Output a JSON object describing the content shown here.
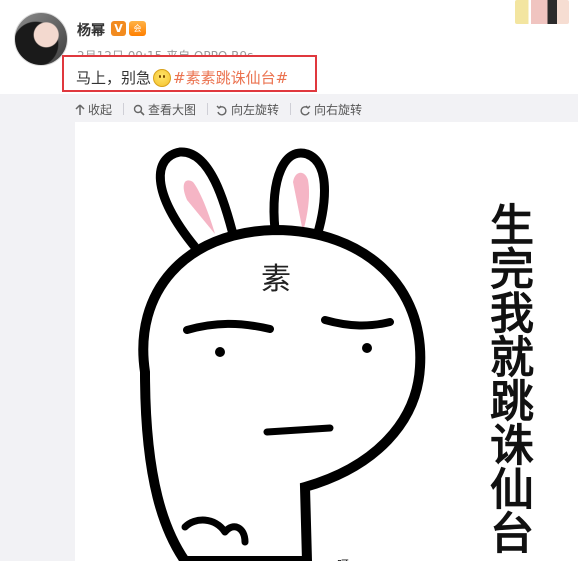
{
  "post": {
    "author": "杨幂",
    "verified_badge": "V",
    "vip_badge": "会",
    "meta": "2月12日 09:15 来自 OPPO R9s",
    "text_before": "马上，别急",
    "emoji": "smile-emoji",
    "hashtag": "#素素跳诛仙台#"
  },
  "toolbar": {
    "collapse_label": "收起",
    "view_large_label": "查看大图",
    "rotate_left_label": "向左旋转",
    "rotate_right_label": "向右旋转"
  },
  "image": {
    "stamp_text": "素",
    "caption_vertical": "生完我就跳诛仙台",
    "bottom_mark": "呀"
  },
  "colors": {
    "highlight_border": "#e0383e",
    "hashtag": "#eb7350",
    "toolbar_bg": "#f2f2f5"
  }
}
